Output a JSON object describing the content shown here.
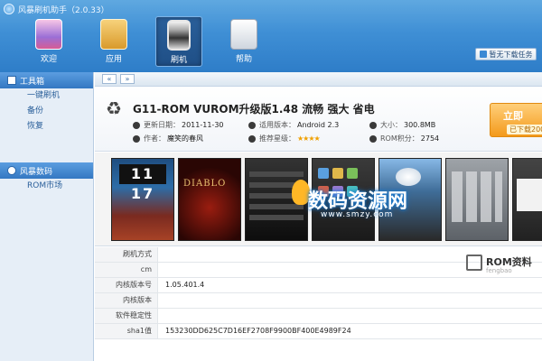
{
  "app": {
    "title": "风暴刷机助手（2.0.33）"
  },
  "nav": {
    "items": [
      {
        "label": "欢迎",
        "icon": "welcome-phone-icon"
      },
      {
        "label": "应用",
        "icon": "apps-box-icon"
      },
      {
        "label": "刷机",
        "icon": "flash-phone-icon",
        "active": true
      },
      {
        "label": "帮助",
        "icon": "help-book-icon"
      }
    ],
    "download_button": "暂无下载任务"
  },
  "sidebar": {
    "sections": [
      {
        "title": "工具箱",
        "items": [
          "一键刷机",
          "备份",
          "恢复"
        ]
      },
      {
        "title": "风暴数码",
        "items": [
          "ROM市场"
        ]
      }
    ]
  },
  "pager": {
    "prev": "«",
    "next": "»"
  },
  "rom": {
    "title": "G11-ROM VUROM升级版1.48 流畅 强大 省电",
    "meta": {
      "update_label": "更新日期：",
      "update_value": "2011-11-30",
      "version_label": "适用版本：",
      "version_value": "Android 2.3",
      "size_label": "大小：",
      "size_value": "300.8MB",
      "author_label": "作者：",
      "author_value": "魔笑的春风",
      "rating_label": "推荐星级：",
      "rating_value": "★★★★",
      "score_label": "ROM积分：",
      "score_value": "2754"
    },
    "download": {
      "label": "立即",
      "sub": "已下载200"
    }
  },
  "screenshots": {
    "clock": "11 17",
    "game_logo": "DIABLO",
    "watermark": "数码资源网",
    "watermark_url": "www.smzy.com"
  },
  "props": {
    "rows": [
      {
        "label": "刷机方式",
        "value": ""
      },
      {
        "label": "cm",
        "value": ""
      },
      {
        "label": "内核版本号",
        "value": "1.05.401.4"
      },
      {
        "label": "内核版本",
        "value": ""
      },
      {
        "label": "软件稳定性",
        "value": ""
      },
      {
        "label": "sha1值",
        "value": "153230DD625C7D16EF2708F9900BF400E4989F24"
      }
    ],
    "brand": "ROM资料",
    "brand_url": "fengbao"
  }
}
